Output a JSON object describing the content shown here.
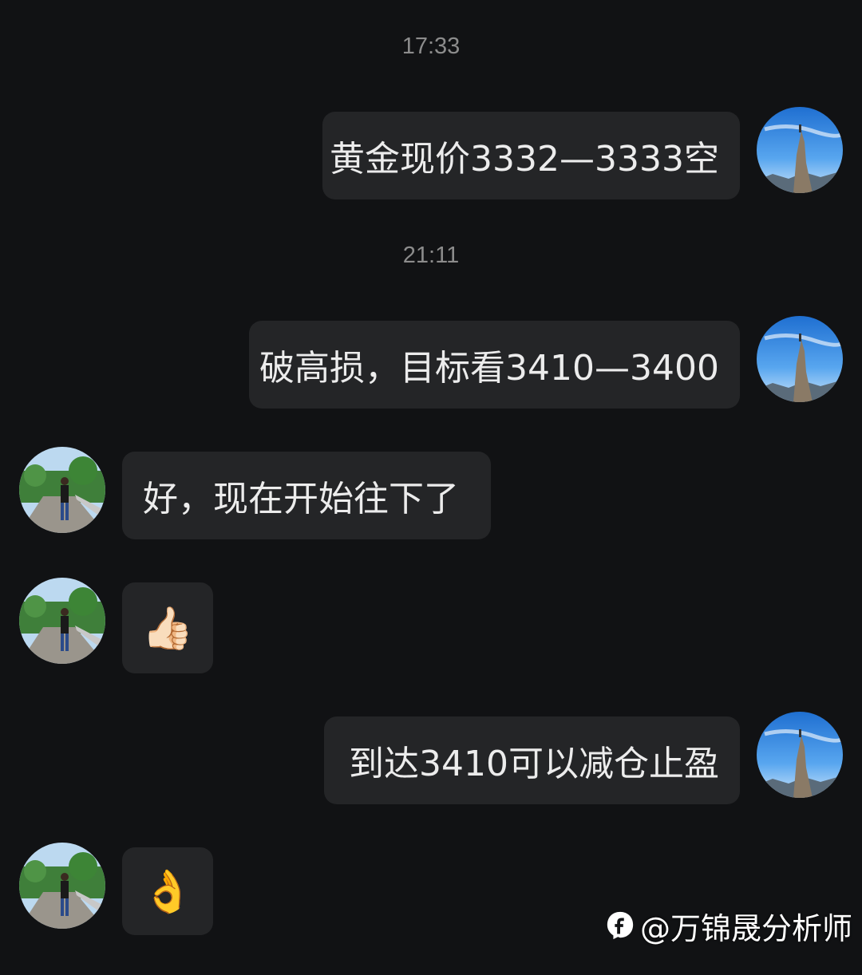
{
  "messages": [
    {
      "type": "timestamp",
      "text": "17:33"
    },
    {
      "type": "message",
      "side": "right",
      "sender": "self",
      "text": "黄金现价3332—3333空"
    },
    {
      "type": "timestamp",
      "text": "21:11"
    },
    {
      "type": "message",
      "side": "right",
      "sender": "self",
      "text": "破高损，目标看3410—3400"
    },
    {
      "type": "message",
      "side": "left",
      "sender": "other",
      "text": "好，现在开始往下了"
    },
    {
      "type": "message",
      "side": "left",
      "sender": "other",
      "text": "👍🏻"
    },
    {
      "type": "message",
      "side": "right",
      "sender": "self",
      "text": "到达3410可以减仓止盈"
    },
    {
      "type": "message",
      "side": "left",
      "sender": "other",
      "text": "👌"
    }
  ],
  "watermark": {
    "logo_icon": "baidu-feed-logo-icon",
    "text": "@万锦晟分析师"
  },
  "colors": {
    "background": "#111214",
    "bubble": "#242527",
    "timestamp": "#8c8c8c",
    "text": "#ececec"
  }
}
